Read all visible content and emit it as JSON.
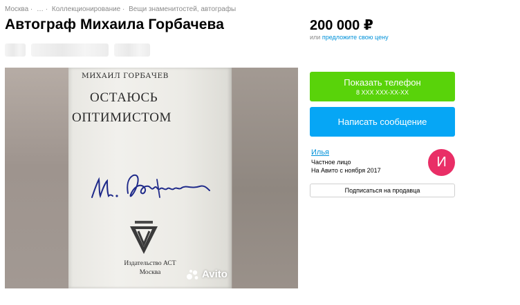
{
  "breadcrumbs": [
    "Москва ·",
    "… ·",
    "Коллекционирование ·",
    "Вещи знаменитостей, автографы"
  ],
  "listing": {
    "title": "Автограф Михаила Горбачева",
    "price": "200 000 ₽",
    "offer_prefix": "или",
    "offer_link": "предложите свою цену"
  },
  "photo": {
    "book_author": "МИХАИЛ ГОРБАЧЕВ",
    "book_title_line1": "ОСТАЮСЬ",
    "book_title_line2": "ОПТИМИСТОМ",
    "publisher_line1": "Издательство АСТ",
    "publisher_line2": "Москва",
    "watermark": "Avito"
  },
  "actions": {
    "show_phone_label": "Показать телефон",
    "phone_masked": "8 XXX XXX-XX-XX",
    "write_message_label": "Написать сообщение",
    "subscribe_label": "Подписаться на продавца"
  },
  "seller": {
    "name": "Илья",
    "type": "Частное лицо",
    "since": "На Авито с ноября 2017",
    "avatar_letter": "И"
  },
  "colors": {
    "phone_button": "#59d30a",
    "message_button": "#06a6f5",
    "link": "#0091d9",
    "avatar": "#e92e66"
  }
}
